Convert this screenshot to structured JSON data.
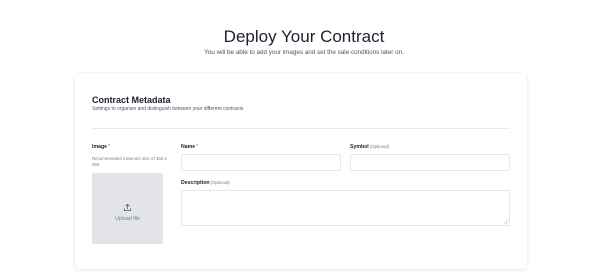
{
  "header": {
    "title": "Deploy Your Contract",
    "subtitle": "You will be able to add your images and set the sale conditions later on."
  },
  "metadata": {
    "title": "Contract Metadata",
    "description": "Settings to organize and distinguish between your different contracts"
  },
  "image": {
    "label": "Image",
    "required_mark": "*",
    "hint": "Recommended minimum size of 350 x 350",
    "upload_label": "Upload file",
    "icon": "upload-icon"
  },
  "name": {
    "label": "Name",
    "required_mark": "*",
    "value": "",
    "placeholder": ""
  },
  "symbol": {
    "label": "Symbol",
    "optional_mark": "(Optional)",
    "value": "",
    "placeholder": ""
  },
  "description_field": {
    "label": "Description",
    "optional_mark": "(Optional)",
    "value": "",
    "placeholder": ""
  },
  "colors": {
    "required": "#e53e3e",
    "upload_bg": "#e2e4e8",
    "muted_text": "#718096"
  }
}
